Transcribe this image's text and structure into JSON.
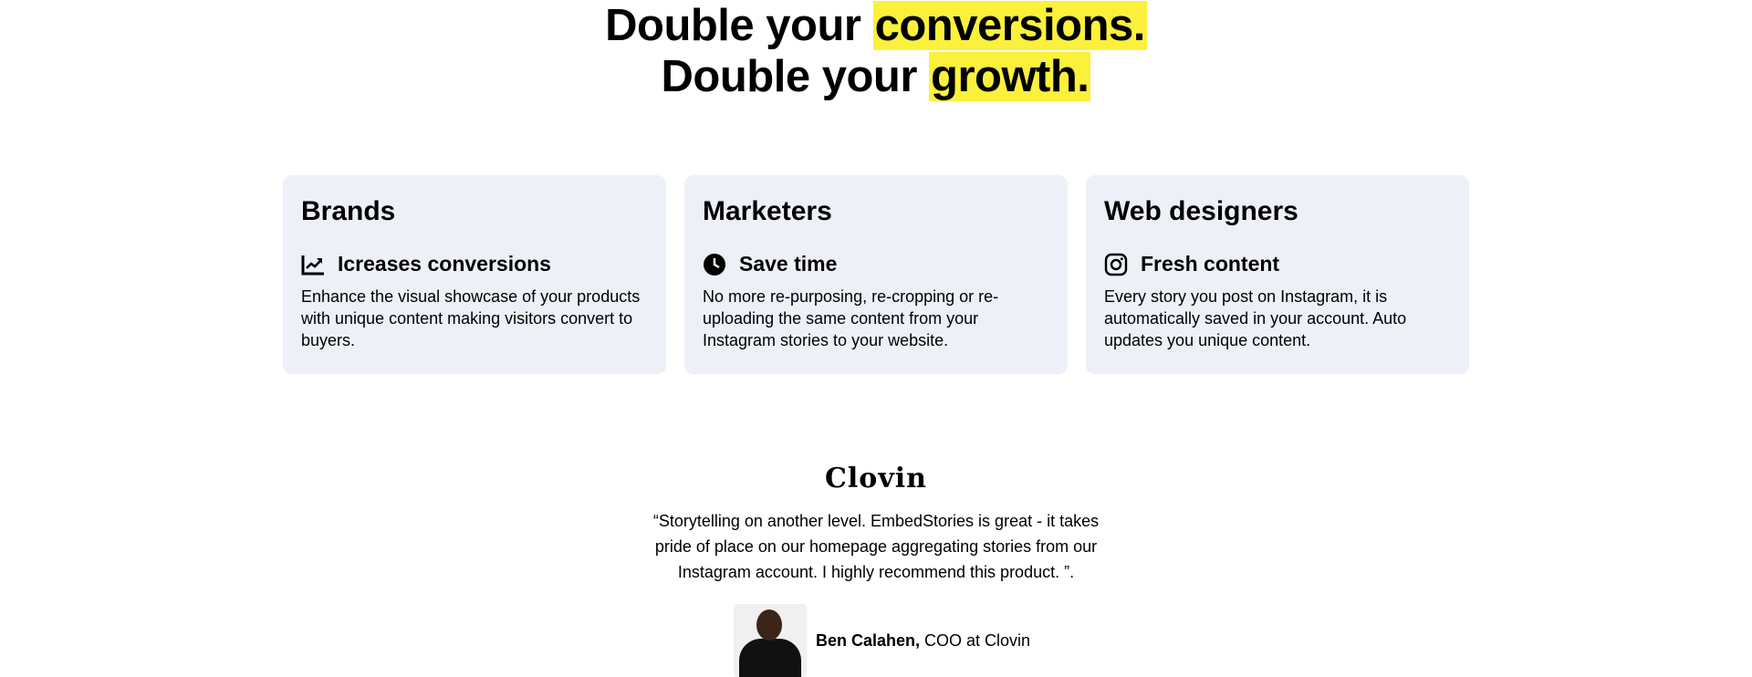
{
  "headline": {
    "line1_prefix": "Double your ",
    "line1_highlight": "conversions.",
    "line2_prefix": "Double your ",
    "line2_highlight": "growth."
  },
  "cards": [
    {
      "title": "Brands",
      "feature_icon": "chart-line-icon",
      "feature": "Icreases conversions",
      "text": "Enhance the visual showcase of your products with unique content making visitors convert to buyers."
    },
    {
      "title": "Marketers",
      "feature_icon": "clock-icon",
      "feature": "Save time",
      "text": "No more re-purposing, re-cropping or re-uploading the same content from your Instagram stories to your website."
    },
    {
      "title": "Web designers",
      "feature_icon": "instagram-icon",
      "feature": "Fresh content",
      "text": "Every story you post on Instagram, it is automatically saved in your account. Auto updates you unique content."
    }
  ],
  "testimonial": {
    "logo": "Clovin",
    "quote": "“Storytelling on another level. EmbedStories is great - it takes pride of place on our homepage aggregating stories from our Instagram account. I highly recommend this product. ”.",
    "author_name": "Ben Calahen,",
    "author_role": " COO at Clovin"
  },
  "colors": {
    "highlight": "#fbf03c",
    "card_bg": "#eef0f7"
  }
}
